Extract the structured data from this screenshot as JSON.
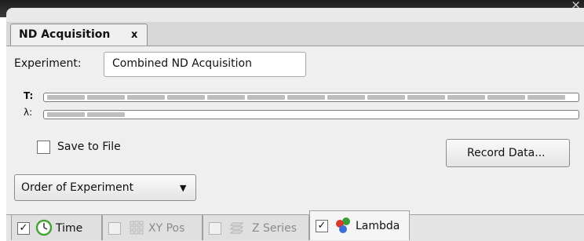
{
  "window": {
    "close_glyph": "×"
  },
  "doc_tab": {
    "title": "ND Acquisition",
    "close_glyph": "x"
  },
  "experiment": {
    "label": "Experiment:",
    "value": "Combined ND Acquisition"
  },
  "timeline": {
    "t_label": "T:",
    "lambda_label": "λ:",
    "t_segments": 13,
    "lambda_segments": 2
  },
  "save_to_file": {
    "label": "Save to File",
    "checked": false
  },
  "record_button": {
    "label": "Record Data..."
  },
  "order_dropdown": {
    "selected": "Order of Experiment",
    "arrow": "▼"
  },
  "dimension_tabs": [
    {
      "label": "Time",
      "checked": true,
      "enabled": true,
      "icon": "clock-icon",
      "check_glyph": "✓"
    },
    {
      "label": "XY Pos",
      "checked": false,
      "enabled": false,
      "icon": "grid-icon",
      "check_glyph": ""
    },
    {
      "label": "Z Series",
      "checked": false,
      "enabled": false,
      "icon": "layers-icon",
      "check_glyph": ""
    },
    {
      "label": "Lambda",
      "checked": true,
      "enabled": true,
      "active": true,
      "icon": "color-dots-icon",
      "check_glyph": "✓"
    }
  ],
  "colors": {
    "titlebar": "#2a2a2a",
    "panel": "#efefef",
    "clock_green": "#4aa23a",
    "lambda_red": "#d93a2b",
    "lambda_green": "#3a9d3a",
    "lambda_blue": "#3a6fd9"
  }
}
